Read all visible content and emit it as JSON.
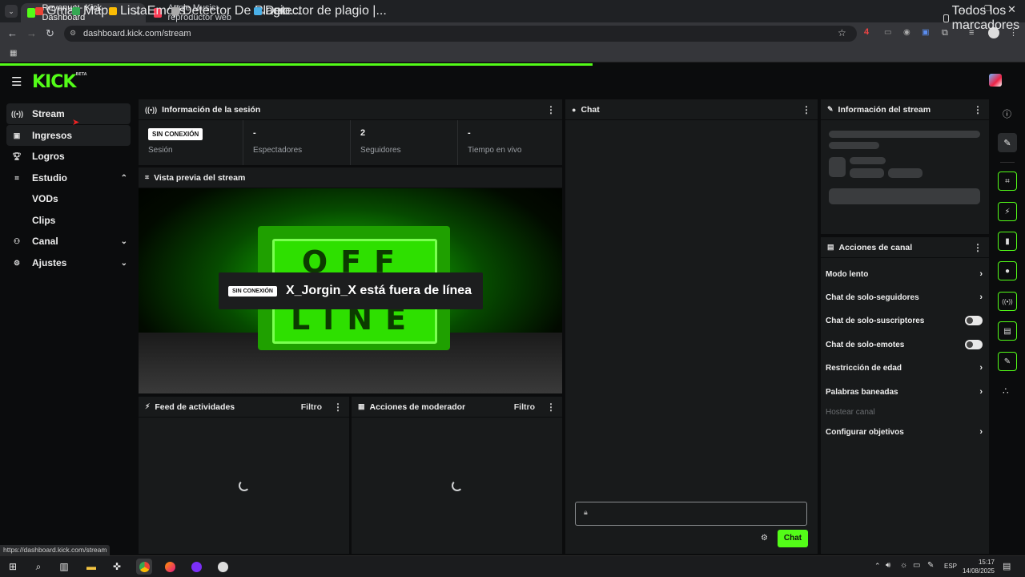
{
  "browser": {
    "tabs": [
      {
        "title": "Revenue - Kick Dashboard",
        "active": true
      },
      {
        "title": "Apple Music: reproductor web",
        "active": false
      }
    ],
    "url": "dashboard.kick.com/stream",
    "bookmarks": [
      "Gmail",
      "Maps",
      "ListaEmojis",
      "Detector De Plagio...",
      "Detector de plagio |..."
    ],
    "all_bookmarks": "Todos los marcadores",
    "status_url": "https://dashboard.kick.com/stream",
    "extension_badge": "4"
  },
  "app": {
    "logo": "KICK",
    "logo_tag": "BETA"
  },
  "sidebar": [
    {
      "label": "Stream",
      "icon": "broadcast-icon"
    },
    {
      "label": "Ingresos",
      "icon": "revenue-icon"
    },
    {
      "label": "Logros",
      "icon": "trophy-icon"
    },
    {
      "label": "Estudio",
      "icon": "studio-icon"
    },
    {
      "label": "VODs"
    },
    {
      "label": "Clips"
    },
    {
      "label": "Canal",
      "icon": "channel-icon"
    },
    {
      "label": "Ajustes",
      "icon": "gear-icon"
    }
  ],
  "session": {
    "title": "Información de la sesión",
    "badge": "SIN CONEXIÓN",
    "session_label": "Sesión",
    "stats": [
      {
        "value": "-",
        "label": "Espectadores"
      },
      {
        "value": "2",
        "label": "Seguidores"
      },
      {
        "value": "-",
        "label": "Tiempo en vivo"
      }
    ]
  },
  "preview": {
    "title": "Vista previa del stream",
    "badge": "SIN CONEXIÓN",
    "message": "X_Jorgin_X está fuera de línea",
    "sign_top": "OFF",
    "sign_bottom": "LINE"
  },
  "feed": {
    "title": "Feed de actividades",
    "filter": "Filtro"
  },
  "mod": {
    "title": "Acciones de moderador",
    "filter": "Filtro"
  },
  "chat": {
    "title": "Chat",
    "send": "Chat"
  },
  "stream_info": {
    "title": "Información del stream"
  },
  "channel_actions": {
    "title": "Acciones de canal",
    "items": [
      {
        "label": "Modo lento",
        "control": "chevron"
      },
      {
        "label": "Chat de solo-seguidores",
        "control": "chevron"
      },
      {
        "label": "Chat de solo-suscriptores",
        "control": "toggle"
      },
      {
        "label": "Chat de solo-emotes",
        "control": "toggle"
      },
      {
        "label": "Restricción de edad",
        "control": "chevron"
      },
      {
        "label": "Palabras baneadas",
        "control": "chevron"
      },
      {
        "label": "Hostear canal",
        "control": "disabled"
      },
      {
        "label": "Configurar objetivos",
        "control": "chevron"
      }
    ]
  },
  "taskbar": {
    "lang": "ESP",
    "time": "15:17",
    "date": "14/08/2025"
  },
  "colors": {
    "accent": "#53fc18",
    "panel": "#181a1b",
    "background": "#0b0c0d"
  }
}
